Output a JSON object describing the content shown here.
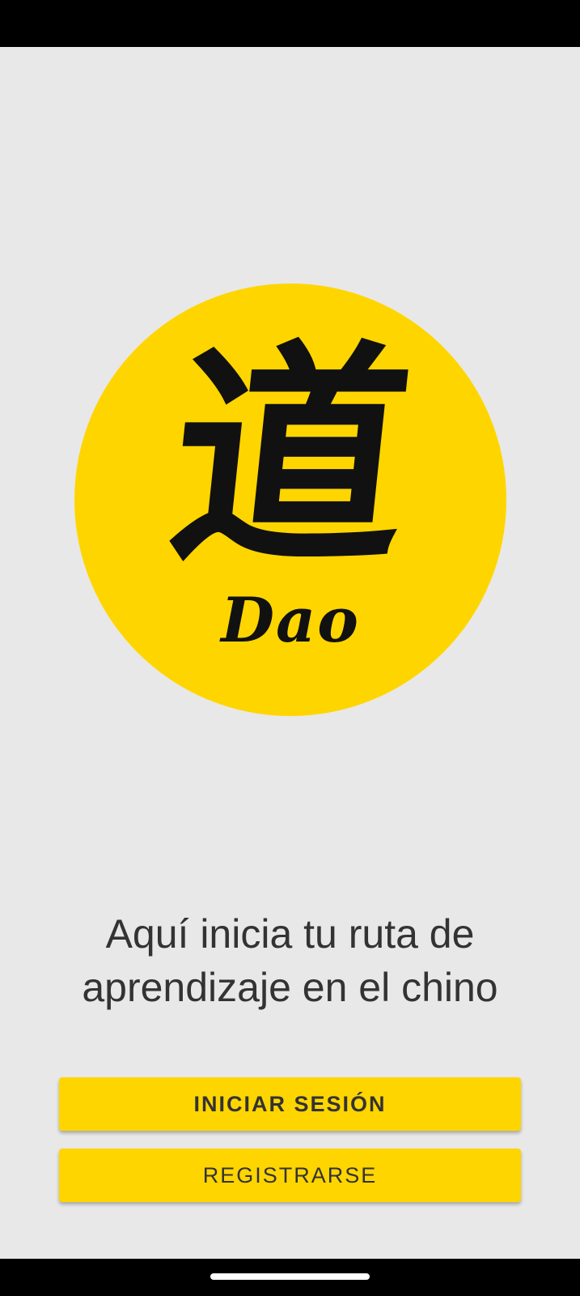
{
  "logo": {
    "glyph": "道",
    "wordmark": "Dao"
  },
  "tagline": "Aquí inicia tu ruta de aprendizaje en el chino",
  "actions": {
    "login_label": "INICIAR SESIÓN",
    "register_label": "REGISTRARSE"
  },
  "colors": {
    "accent": "#ffd500",
    "background": "#e8e8e8",
    "text": "#333333"
  }
}
